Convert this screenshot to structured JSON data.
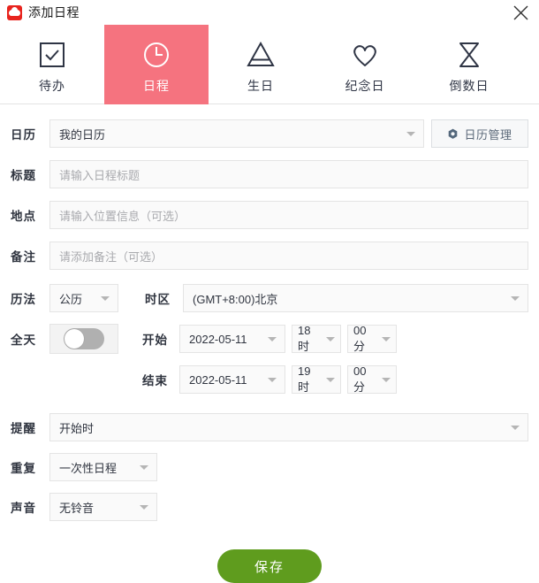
{
  "window": {
    "title": "添加日程",
    "app_icon": "cloud-app-icon",
    "close_icon": "close-icon"
  },
  "tabs": [
    {
      "label": "待办",
      "icon": "checkbox-icon",
      "active": false
    },
    {
      "label": "日程",
      "icon": "clock-icon",
      "active": true
    },
    {
      "label": "生日",
      "icon": "cake-icon",
      "active": false
    },
    {
      "label": "纪念日",
      "icon": "heart-icon",
      "active": false
    },
    {
      "label": "倒数日",
      "icon": "hourglass-icon",
      "active": false
    }
  ],
  "form": {
    "calendar": {
      "label": "日历",
      "value": "我的日历",
      "manage_button": "日历管理",
      "manage_icon": "gear-icon"
    },
    "title": {
      "label": "标题",
      "value": "",
      "placeholder": "请输入日程标题"
    },
    "location": {
      "label": "地点",
      "value": "",
      "placeholder": "请输入位置信息（可选）"
    },
    "note": {
      "label": "备注",
      "value": "",
      "placeholder": "请添加备注（可选）"
    },
    "calendar_system": {
      "label": "历法",
      "value": "公历"
    },
    "timezone": {
      "label": "时区",
      "value": "(GMT+8:00)北京"
    },
    "all_day": {
      "label": "全天",
      "state": "off"
    },
    "start": {
      "label": "开始",
      "date": "2022-05-11",
      "hour": "18时",
      "minute": "00分"
    },
    "end": {
      "label": "结束",
      "date": "2022-05-11",
      "hour": "19时",
      "minute": "00分"
    },
    "reminder": {
      "label": "提醒",
      "value": "开始时"
    },
    "repeat": {
      "label": "重复",
      "value": "一次性日程"
    },
    "sound": {
      "label": "声音",
      "value": "无铃音"
    }
  },
  "footer": {
    "save_label": "保存"
  },
  "colors": {
    "accent_pink": "#f5737f",
    "save_green": "#5f9c1e",
    "app_red": "#e8241e",
    "icon_dark": "#2f3545"
  }
}
